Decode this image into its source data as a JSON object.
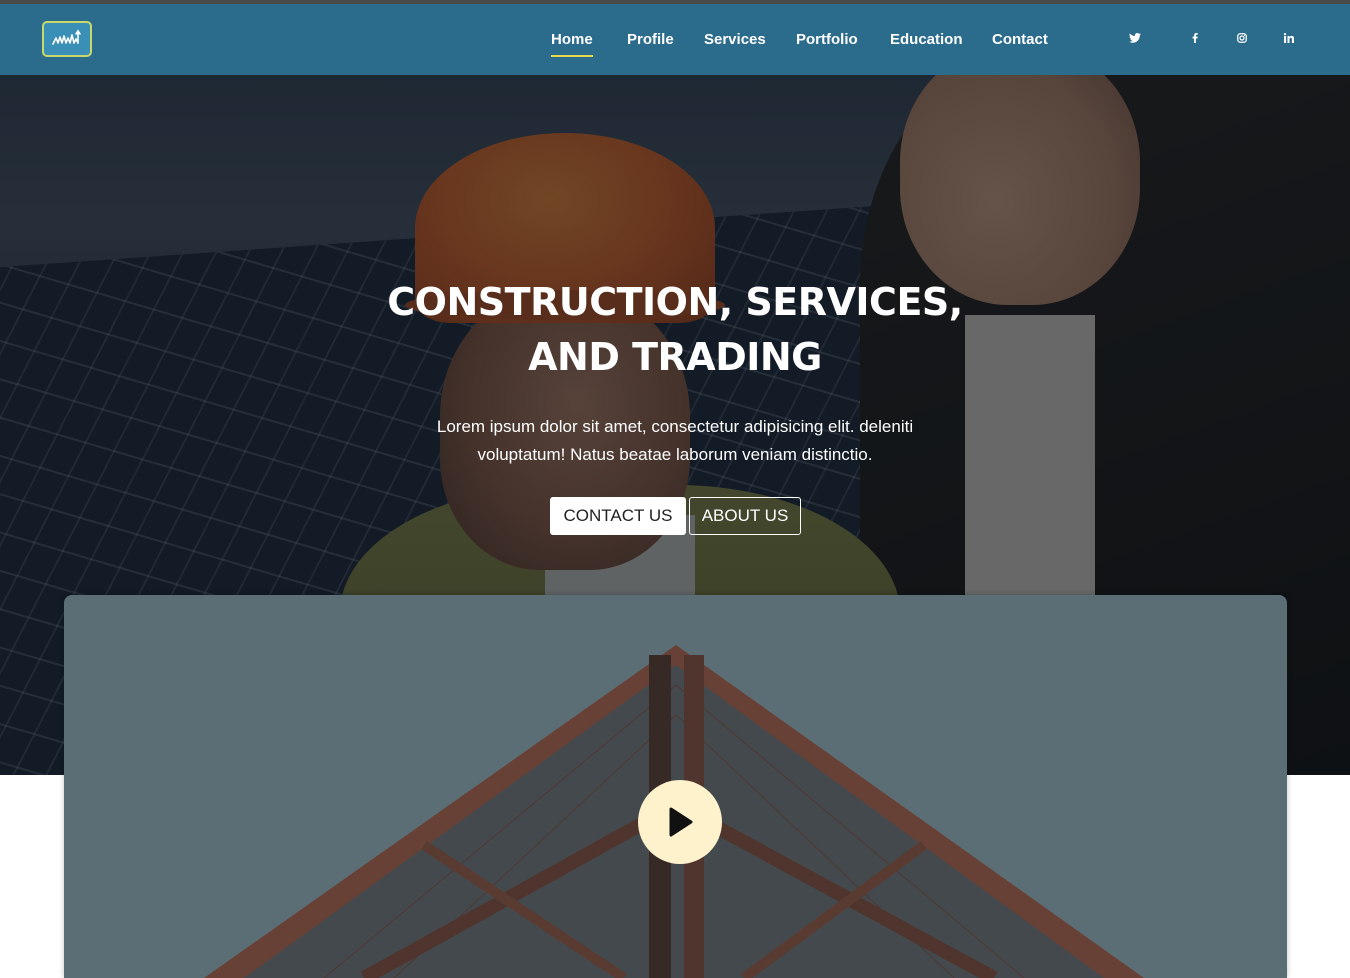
{
  "nav": {
    "logo_alt": "logo",
    "links": [
      {
        "label": "Home",
        "active": true
      },
      {
        "label": "Profile",
        "active": false
      },
      {
        "label": "Services",
        "active": false
      },
      {
        "label": "Portfolio",
        "active": false
      },
      {
        "label": "Education",
        "active": false
      },
      {
        "label": "Contact",
        "active": false
      }
    ],
    "social_icons": [
      "twitter-icon",
      "facebook-icon",
      "instagram-icon",
      "linkedin-icon"
    ]
  },
  "hero": {
    "title_line1": "CONSTRUCTION, SERVICES,",
    "title_line2": "AND TRADING",
    "text": "Lorem ipsum dolor sit amet, consectetur adipisicing elit. deleniti voluptatum! Natus beatae laborum veniam distinctio.",
    "contact_button": "CONTACT US",
    "about_button": "ABOUT US"
  },
  "video": {
    "play_icon": "play-icon"
  },
  "colors": {
    "navbar": "#2b6b8c",
    "nav_active_underline": "#e8d84a",
    "play_button_bg": "#fdf2cc",
    "video_card_bg": "#6c8087"
  }
}
